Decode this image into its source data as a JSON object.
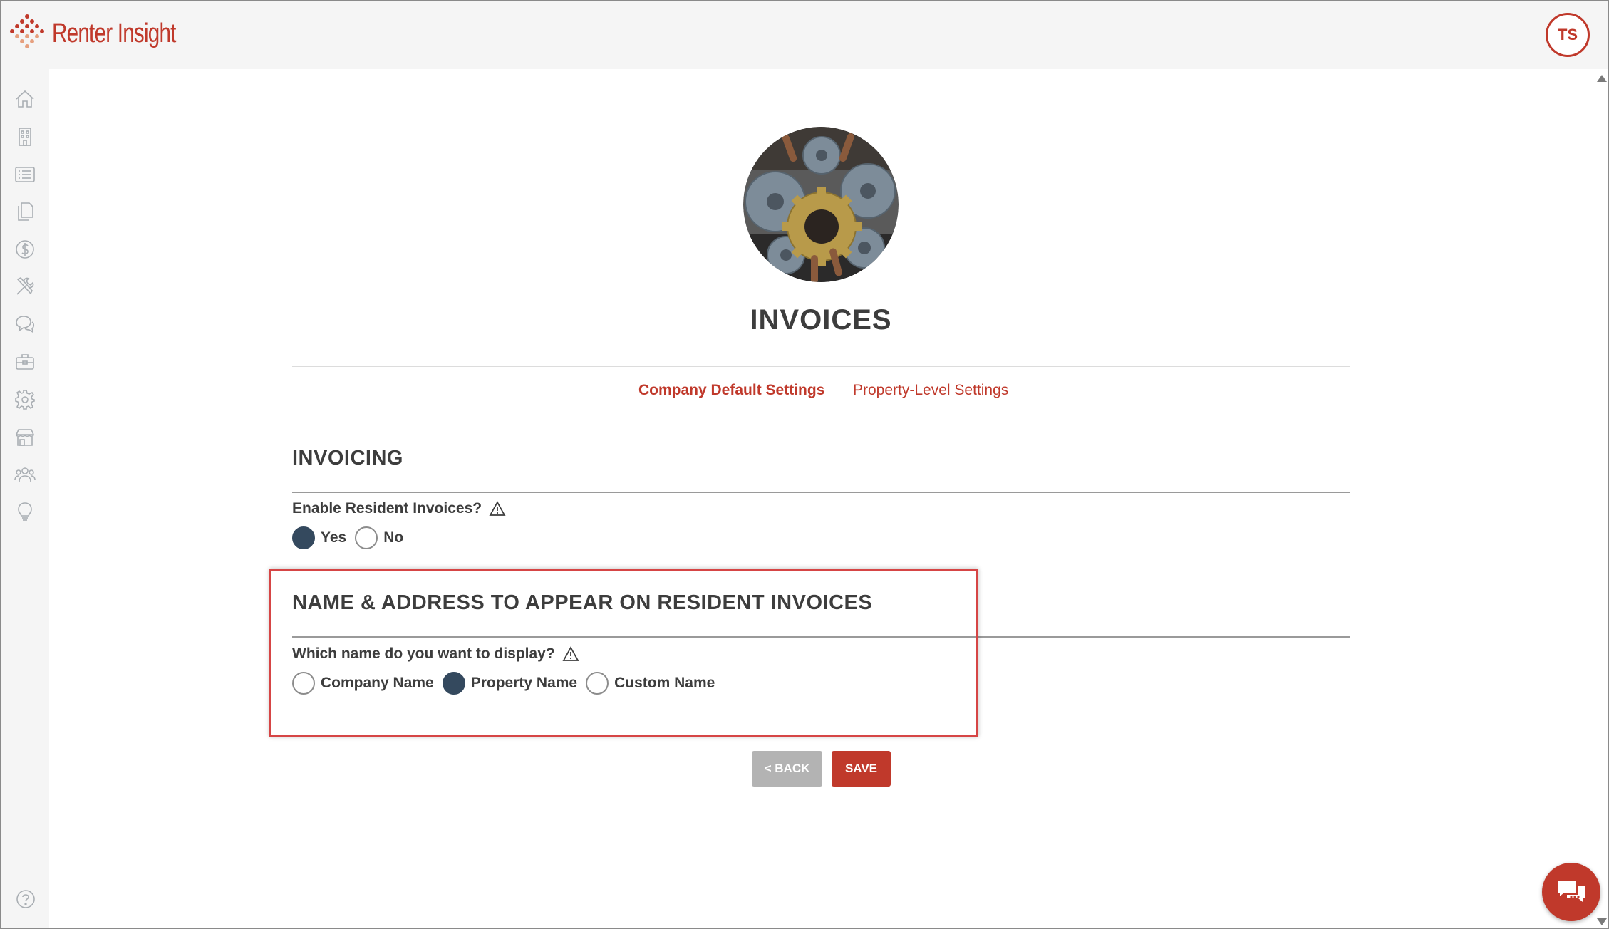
{
  "app": {
    "name": "Renter Insight",
    "user_initials": "TS",
    "brand_color": "#c0392b"
  },
  "sidebar": {
    "items": [
      {
        "icon": "home-icon"
      },
      {
        "icon": "building-icon"
      },
      {
        "icon": "list-icon"
      },
      {
        "icon": "documents-icon"
      },
      {
        "icon": "dollar-icon"
      },
      {
        "icon": "tools-icon"
      },
      {
        "icon": "chat-bubbles-icon"
      },
      {
        "icon": "briefcase-icon"
      },
      {
        "icon": "gear-icon"
      },
      {
        "icon": "storefront-icon"
      },
      {
        "icon": "people-icon"
      },
      {
        "icon": "lightbulb-icon"
      }
    ],
    "help_icon": "help-icon"
  },
  "page": {
    "title": "INVOICES",
    "tabs": [
      {
        "label": "Company Default Settings",
        "active": true
      },
      {
        "label": "Property-Level Settings",
        "active": false
      }
    ]
  },
  "invoicing": {
    "section_title": "INVOICING",
    "question": "Enable Resident Invoices?",
    "options": [
      {
        "label": "Yes",
        "checked": true
      },
      {
        "label": "No",
        "checked": false
      }
    ]
  },
  "name_address": {
    "section_title": "NAME & ADDRESS TO APPEAR ON RESIDENT INVOICES",
    "question": "Which name do you want to display?",
    "options": [
      {
        "label": "Company Name",
        "checked": false
      },
      {
        "label": "Property Name",
        "checked": true
      },
      {
        "label": "Custom Name",
        "checked": false
      }
    ]
  },
  "actions": {
    "back_label": "< BACK",
    "save_label": "SAVE"
  },
  "colors": {
    "accent": "#c0392b",
    "radio_checked": "#34495e",
    "highlight": "#d64545"
  }
}
